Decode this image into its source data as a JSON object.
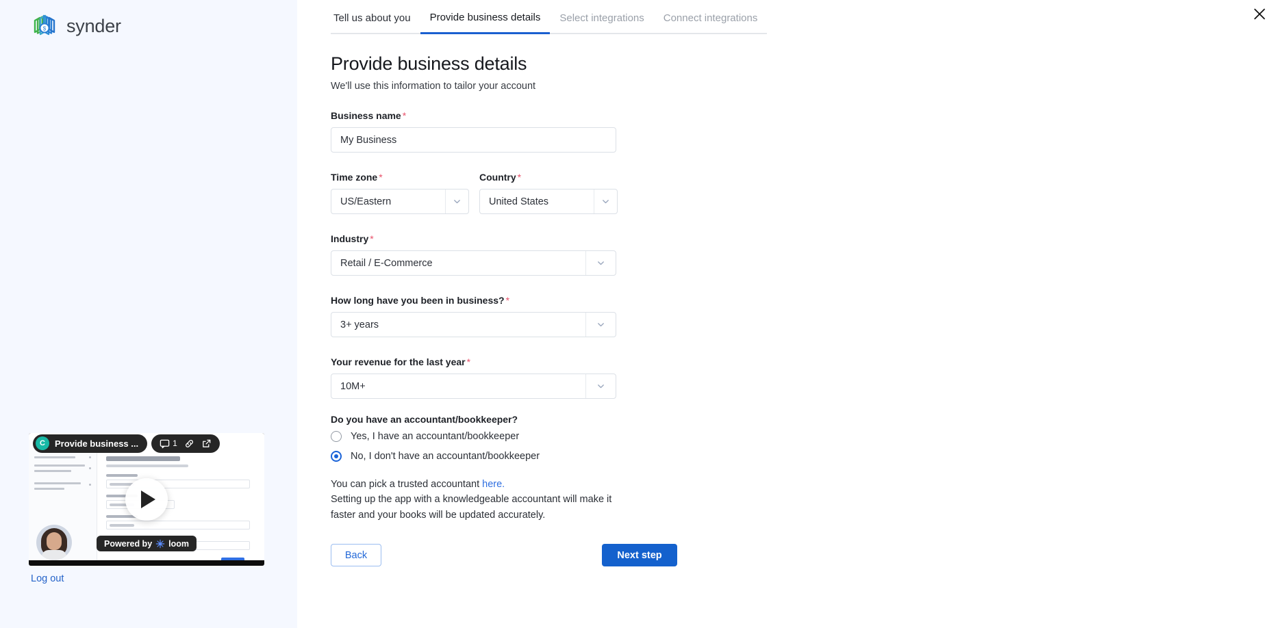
{
  "brand": {
    "name": "synder",
    "accent": "#1461cd",
    "logo_green": "#3bb54a",
    "logo_blue": "#2a7fd4"
  },
  "sidebar": {
    "logout_label": "Log out",
    "video": {
      "avatar_initial": "C",
      "title": "Provide business ...",
      "comment_count": "1",
      "powered_prefix": "Powered by",
      "brand": "loom"
    }
  },
  "tabs": [
    {
      "label": "Tell us about you",
      "state": "done"
    },
    {
      "label": "Provide business details",
      "state": "active"
    },
    {
      "label": "Select integrations",
      "state": "disabled"
    },
    {
      "label": "Connect integrations",
      "state": "disabled"
    }
  ],
  "page": {
    "title": "Provide business details",
    "subtitle": "We'll use this information to tailor your account"
  },
  "form": {
    "business_name": {
      "label": "Business name",
      "required": "*",
      "value": "My Business",
      "placeholder": "Business name"
    },
    "time_zone": {
      "label": "Time zone",
      "required": "*",
      "value": "US/Eastern"
    },
    "country": {
      "label": "Country",
      "required": "*",
      "value": "United States"
    },
    "industry": {
      "label": "Industry",
      "required": "*",
      "value": "Retail / E-Commerce"
    },
    "years_in_business": {
      "label": "How long have you been in business?",
      "required": "*",
      "value": "3+ years"
    },
    "revenue": {
      "label": "Your revenue for the last year",
      "required": "*",
      "value": "10M+"
    },
    "accountant": {
      "label": "Do you have an accountant/bookkeeper?",
      "options": [
        {
          "label": "Yes, I have an accountant/bookkeeper",
          "checked": false
        },
        {
          "label": "No, I don't have an accountant/bookkeeper",
          "checked": true
        }
      ]
    }
  },
  "helper": {
    "line1_before": "You can pick a trusted accountant ",
    "link": "here.",
    "line2": "Setting up the app with a knowledgeable accountant will make it",
    "line3": "faster and your books will be updated accurately."
  },
  "actions": {
    "back": "Back",
    "next": "Next step"
  }
}
